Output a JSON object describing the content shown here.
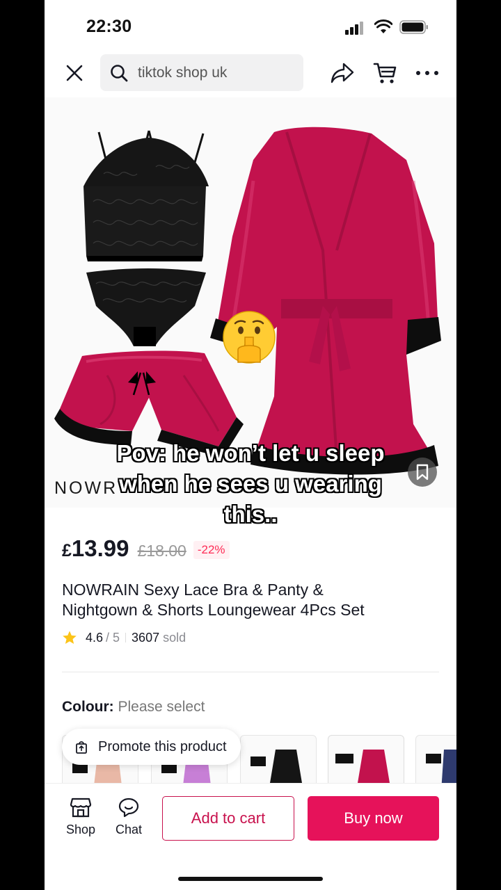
{
  "status_bar": {
    "time": "22:30"
  },
  "search": {
    "query": "tiktok shop uk"
  },
  "product_image": {
    "brand_mark": "NOWR",
    "caption_line1": "Pov: he won’t let u sleep",
    "caption_line2": "when he sees u wearing",
    "caption_line3": "this..",
    "emoji": "🤫"
  },
  "pricing": {
    "currency": "£",
    "price": "13.99",
    "original_price": "£18.00",
    "discount": "-22%"
  },
  "product": {
    "title_line1": "NOWRAIN Sexy Lace Bra & Panty &",
    "title_line2": "Nightgown & Shorts Loungewear 4Pcs Set",
    "rating": "4.6",
    "rating_max": "/ 5",
    "sold_count": "3607",
    "sold_label": "sold"
  },
  "options": {
    "colour_label": "Colour:",
    "colour_value": "Please select"
  },
  "promote": {
    "label": "Promote this product"
  },
  "bottom_bar": {
    "shop_label": "Shop",
    "chat_label": "Chat",
    "add_to_cart": "Add to cart",
    "buy_now": "Buy now"
  },
  "colors": {
    "accent": "#e6125a",
    "satin": "#c2124d",
    "lace": "#111111"
  }
}
